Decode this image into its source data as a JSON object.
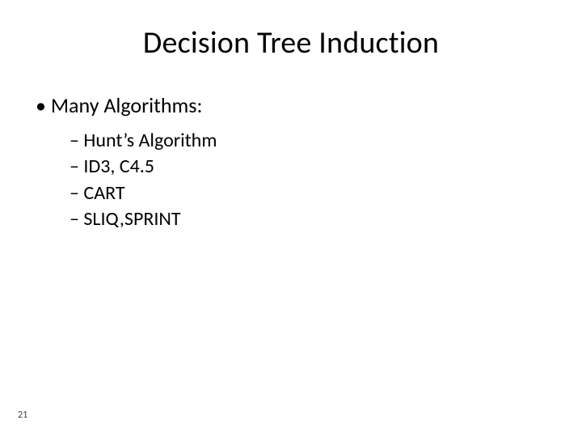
{
  "title": "Decision Tree Induction",
  "bullet": "Many Algorithms:",
  "sub": {
    "a": "Hunt’s Algorithm",
    "b": "ID3, C4.5",
    "c": "CART",
    "d": "SLIQ,SPRINT"
  },
  "page": "21"
}
